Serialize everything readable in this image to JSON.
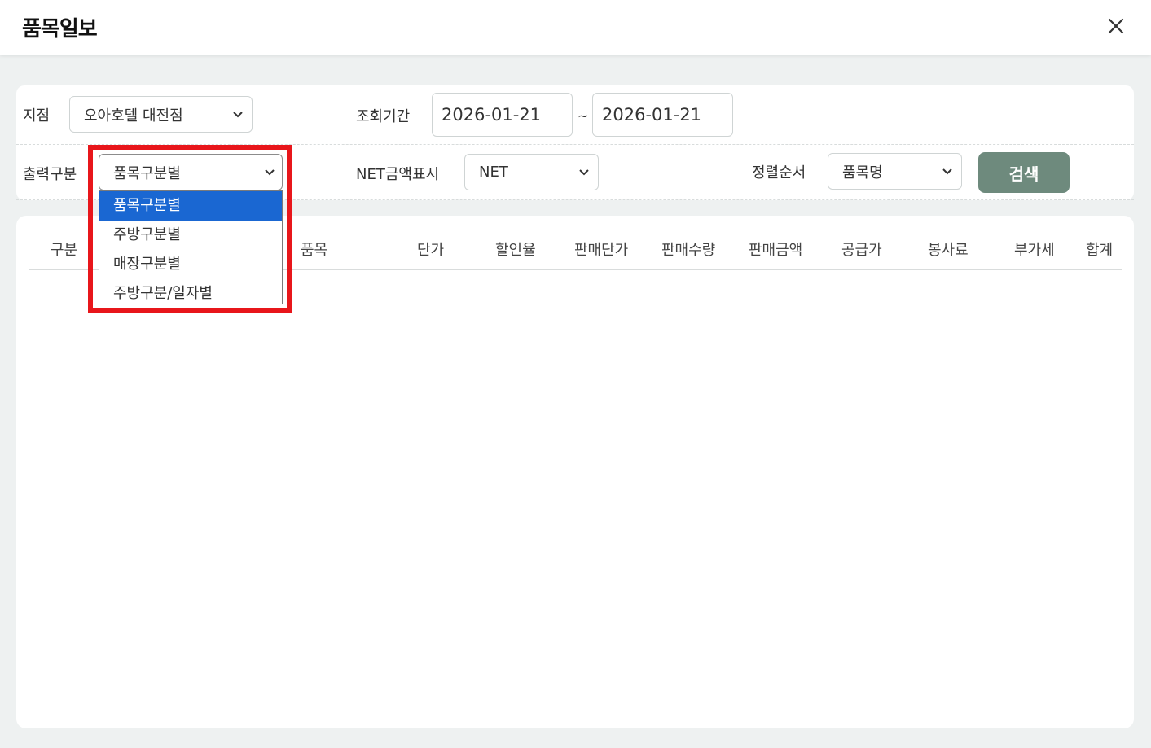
{
  "window": {
    "title": "품목일보",
    "close_icon": "close-icon"
  },
  "filters": {
    "branch_label": "지점",
    "branch_value": "오아호텔 대전점",
    "period_label": "조회기간",
    "date_from": "2026-01-21",
    "date_separator": "~",
    "date_to": "2026-01-21",
    "output_label": "출력구분",
    "output_value": "품목구분별",
    "output_options": [
      "품목구분별",
      "주방구분별",
      "매장구분별",
      "주방구분/일자별"
    ],
    "net_label": "NET금액표시",
    "net_value": "NET",
    "sort_label": "정렬순서",
    "sort_value": "품목명",
    "search_button": "검색"
  },
  "table": {
    "columns": [
      "구분",
      "품목",
      "단가",
      "할인율",
      "판매단가",
      "판매수량",
      "판매금액",
      "공급가",
      "봉사료",
      "부가세",
      "합계"
    ],
    "rows": []
  },
  "colors": {
    "search_button": "#6e8a7d",
    "highlight_border": "#e8161b",
    "selected_option": "#1a67d2"
  }
}
